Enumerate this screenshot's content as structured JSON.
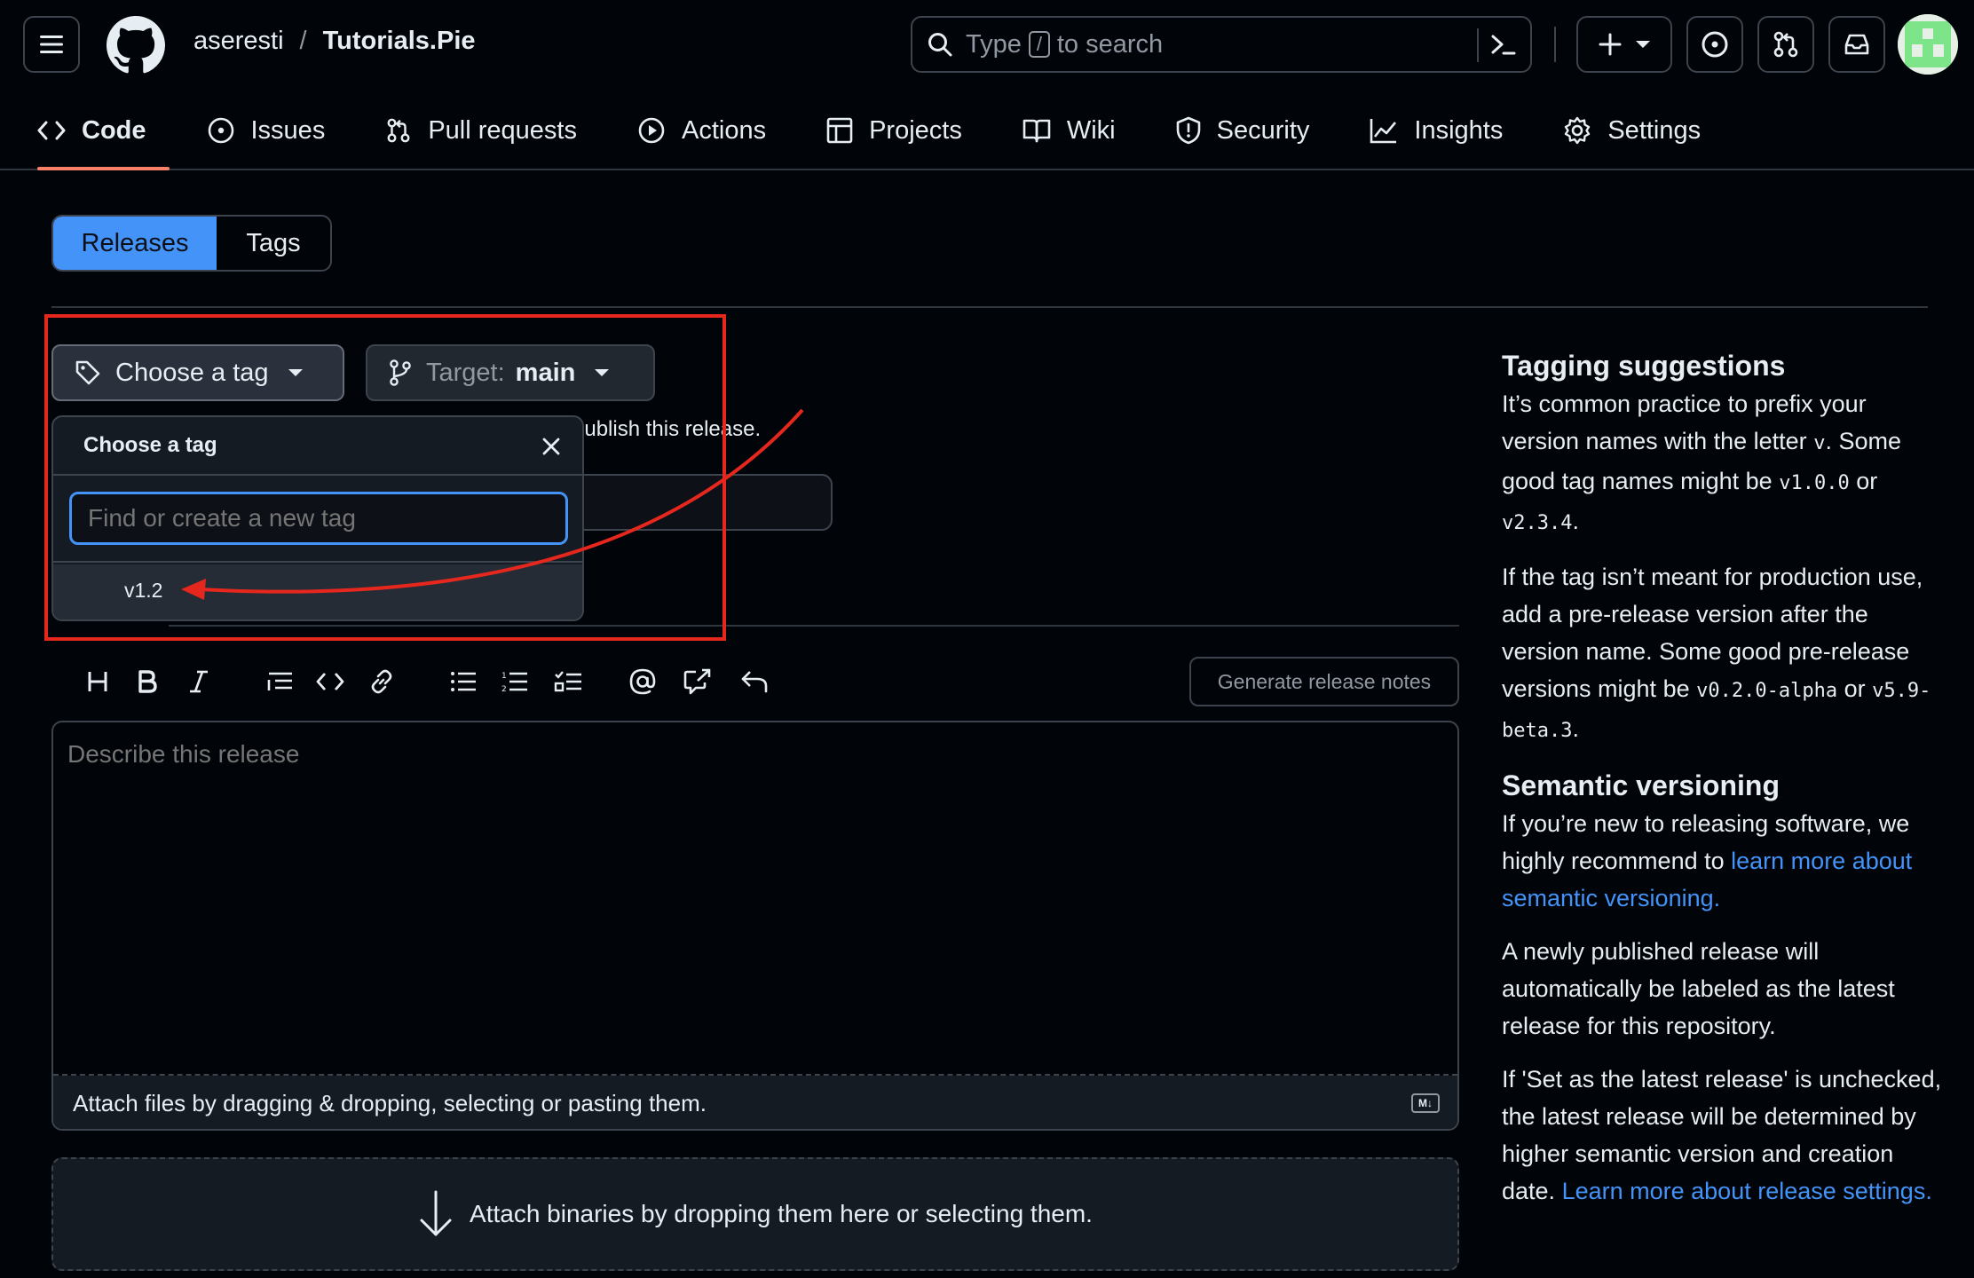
{
  "header": {
    "owner": "aseresti",
    "separator": "/",
    "repo": "Tutorials.Pie",
    "search": {
      "before": "Type",
      "key": "/",
      "after": "to search"
    }
  },
  "nav": [
    {
      "label": "Code",
      "icon": "code-icon",
      "active": true
    },
    {
      "label": "Issues",
      "icon": "issue-opened-icon"
    },
    {
      "label": "Pull requests",
      "icon": "git-pull-request-icon"
    },
    {
      "label": "Actions",
      "icon": "play-icon"
    },
    {
      "label": "Projects",
      "icon": "table-icon"
    },
    {
      "label": "Wiki",
      "icon": "book-icon"
    },
    {
      "label": "Security",
      "icon": "shield-icon"
    },
    {
      "label": "Insights",
      "icon": "graph-icon"
    },
    {
      "label": "Settings",
      "icon": "gear-icon"
    }
  ],
  "segmented": {
    "releases": "Releases",
    "tags": "Tags"
  },
  "release_form": {
    "choose_tag": "Choose a tag",
    "target_label": "Target:",
    "target_value": "main",
    "publish_hint": "publish this release.",
    "generate_notes": "Generate release notes",
    "editor_placeholder": "Describe this release",
    "attach_files": "Attach files by dragging & dropping, selecting or pasting them.",
    "markdown_badge": "M↓",
    "attach_binaries": "Attach binaries by dropping them here or selecting them."
  },
  "tag_dropdown": {
    "title": "Choose a tag",
    "placeholder": "Find or create a new tag",
    "items": [
      "v1.2"
    ]
  },
  "sidebar": {
    "tagging": {
      "title": "Tagging suggestions",
      "p1_text": "It’s common practice to prefix your version names with the letter",
      "p1_code": "v",
      "p1_text2": ". Some good tag names might be",
      "p1_code2": "v1.0.0",
      "p1_or": "or",
      "p1_code3": "v2.3.4",
      "p1_end": ".",
      "p2_text": "If the tag isn’t meant for production use, add a pre-release version after the version name. Some good pre-release versions might be",
      "p2_code": "v0.2.0-alpha",
      "p2_or": "or",
      "p2_code2": "v5.9-beta.3",
      "p2_end": "."
    },
    "semver": {
      "title": "Semantic versioning",
      "p1_text": "If you’re new to releasing software, we highly recommend to",
      "p1_link": "learn more about semantic versioning.",
      "p2": "A newly published release will automatically be labeled as the latest release for this repository.",
      "p3_text": "If 'Set as the latest release' is unchecked, the latest release will be determined by higher semantic version and creation date.",
      "p3_link": "Learn more about release settings."
    }
  },
  "colors": {
    "background": "#010409",
    "accent": "#4493f8",
    "active_tab_underline": "#f78166",
    "annotation": "#e5271e",
    "border": "#3d444d"
  }
}
